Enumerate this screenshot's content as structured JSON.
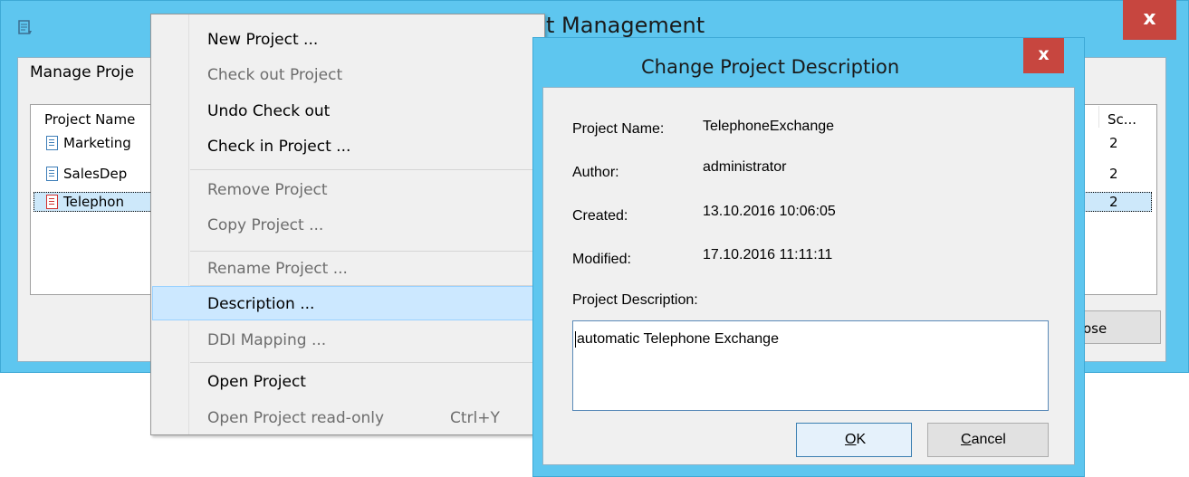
{
  "main_window": {
    "title": "t Management",
    "close_glyph": "x",
    "manage_label": "Manage Proje",
    "columns": [
      "Project Name",
      "Sc..."
    ],
    "rows": [
      {
        "name": "Marketing",
        "sc": "2",
        "icon": "project-doc-icon"
      },
      {
        "name": "SalesDep",
        "sc": "2",
        "icon": "project-doc-icon"
      },
      {
        "name": "Telephon",
        "sc": "2",
        "icon": "project-doc-checkedout-icon"
      }
    ],
    "close_button": "ose"
  },
  "context_menu": {
    "items": [
      {
        "label": "New Project ...",
        "enabled": true
      },
      {
        "label": "Check out Project",
        "enabled": false
      },
      {
        "label": "Undo Check out",
        "enabled": true
      },
      {
        "label": "Check in Project ...",
        "enabled": true
      },
      {
        "label": "Remove Project",
        "enabled": false
      },
      {
        "label": "Copy Project ...",
        "enabled": false
      },
      {
        "label": "Rename Project ...",
        "enabled": false
      },
      {
        "label": "Description ...",
        "enabled": true,
        "highlighted": true
      },
      {
        "label": "DDI Mapping ...",
        "enabled": false
      },
      {
        "label": "Open Project",
        "enabled": true
      },
      {
        "label": "Open Project read-only",
        "enabled": false,
        "shortcut": "Ctrl+Y"
      }
    ]
  },
  "dialog": {
    "title": "Change Project Description",
    "close_glyph": "x",
    "fields": {
      "project_name_label": "Project Name:",
      "project_name_value": "TelephoneExchange",
      "author_label": "Author:",
      "author_value": "administrator",
      "created_label": "Created:",
      "created_value": "13.10.2016 10:06:05",
      "modified_label": "Modified:",
      "modified_value": "17.10.2016 11:11:11"
    },
    "description_label": "Project Description:",
    "description_value": "automatic Telephone Exchange",
    "ok_mnemonic": "O",
    "ok_rest": "K",
    "cancel_mnemonic": "C",
    "cancel_rest": "ancel"
  },
  "colors": {
    "window_frame": "#5ec6ef",
    "close_button": "#c7463f",
    "menu_highlight": "#cce8ff"
  }
}
